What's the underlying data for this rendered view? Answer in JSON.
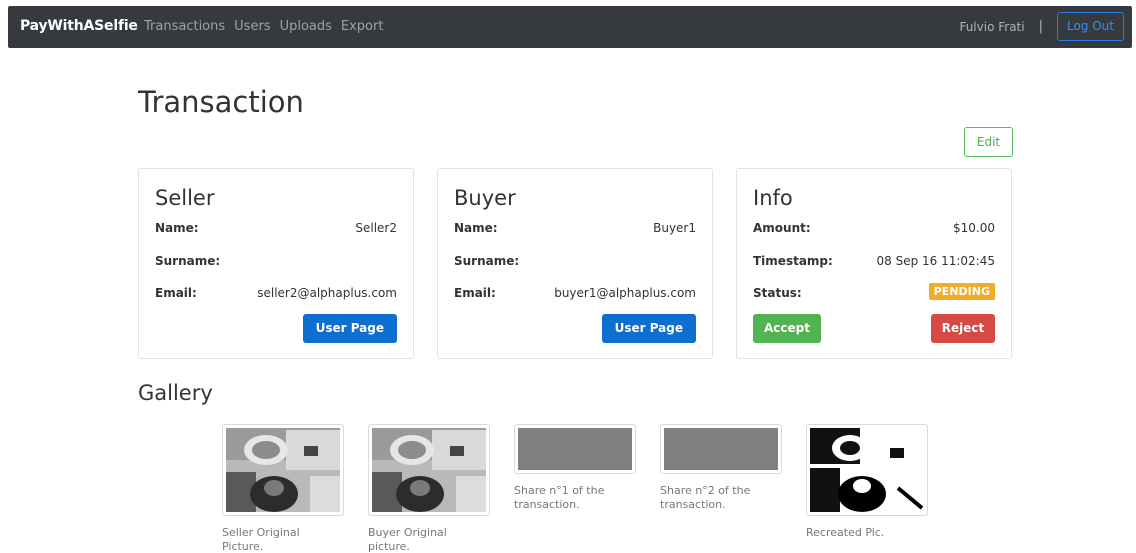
{
  "nav": {
    "brand": "PayWithASelfie",
    "links": [
      "Transactions",
      "Users",
      "Uploads",
      "Export"
    ],
    "user": "Fulvio Frati",
    "separator": "|",
    "logout": "Log Out"
  },
  "page": {
    "title": "Transaction",
    "edit_label": "Edit"
  },
  "seller": {
    "title": "Seller",
    "name_label": "Name:",
    "name": "Seller2",
    "surname_label": "Surname:",
    "surname": "",
    "email_label": "Email:",
    "email": "seller2@alphaplus.com",
    "button": "User Page"
  },
  "buyer": {
    "title": "Buyer",
    "name_label": "Name:",
    "name": "Buyer1",
    "surname_label": "Surname:",
    "surname": "",
    "email_label": "Email:",
    "email": "buyer1@alphaplus.com",
    "button": "User Page"
  },
  "info": {
    "title": "Info",
    "amount_label": "Amount:",
    "amount": "$10.00",
    "timestamp_label": "Timestamp:",
    "timestamp": "08 Sep 16 11:02:45",
    "status_label": "Status:",
    "status": "PENDING",
    "accept": "Accept",
    "reject": "Reject"
  },
  "gallery": {
    "title": "Gallery",
    "items": [
      {
        "caption": "Seller Original Picture.",
        "kind": "photo"
      },
      {
        "caption": "Buyer Original picture.",
        "kind": "photo"
      },
      {
        "caption": "Share n°1 of the transaction.",
        "kind": "share"
      },
      {
        "caption": "Share n°2 of the transaction.",
        "kind": "share"
      },
      {
        "caption": "Recreated Pic.",
        "kind": "recreated"
      }
    ]
  },
  "colors": {
    "navbar": "#363a3f",
    "primary": "#0f6fd0",
    "success": "#52b350",
    "danger": "#d54a44",
    "warning": "#f0ad28"
  }
}
